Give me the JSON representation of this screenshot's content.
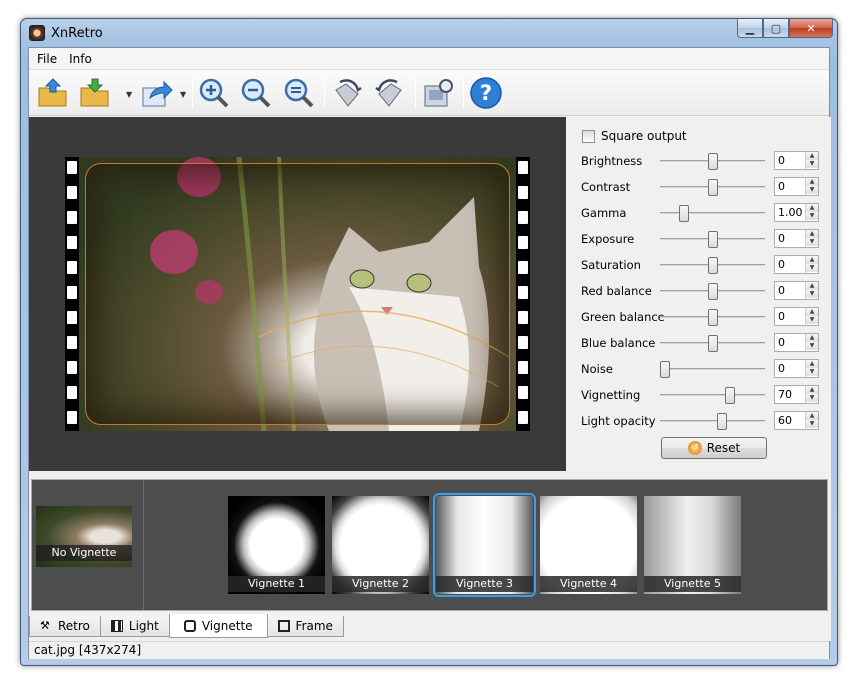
{
  "window": {
    "title": "XnRetro"
  },
  "menu": {
    "items": [
      "File",
      "Info"
    ]
  },
  "toolbar": {
    "buttons": [
      "open-icon",
      "save-icon",
      "share-icon",
      "zoom-in-icon",
      "zoom-out-icon",
      "zoom-fit-icon",
      "rotate-right-icon",
      "rotate-left-icon",
      "settings-icon",
      "help-icon"
    ]
  },
  "controls": {
    "square_output_label": "Square output",
    "square_output_checked": false,
    "sliders": [
      {
        "label": "Brightness",
        "value": "0",
        "level": 0.5
      },
      {
        "label": "Contrast",
        "value": "0",
        "level": 0.5
      },
      {
        "label": "Gamma",
        "value": "1.00",
        "level": 0.2
      },
      {
        "label": "Exposure",
        "value": "0",
        "level": 0.5
      },
      {
        "label": "Saturation",
        "value": "0",
        "level": 0.5
      },
      {
        "label": "Red balance",
        "value": "0",
        "level": 0.5
      },
      {
        "label": "Green balance",
        "value": "0",
        "level": 0.5
      },
      {
        "label": "Blue balance",
        "value": "0",
        "level": 0.5
      },
      {
        "label": "Noise",
        "value": "0",
        "level": 0.0
      },
      {
        "label": "Vignetting",
        "value": "70",
        "level": 0.68
      },
      {
        "label": "Light opacity",
        "value": "60",
        "level": 0.6
      }
    ],
    "reset_label": "Reset"
  },
  "gallery": {
    "current_label": "No Vignette",
    "items": [
      "Vignette 1",
      "Vignette 2",
      "Vignette 3",
      "Vignette 4",
      "Vignette 5"
    ],
    "selected_index": 2
  },
  "tabs": [
    "Retro",
    "Light",
    "Vignette",
    "Frame"
  ],
  "active_tab": "Vignette",
  "status": {
    "text": "cat.jpg [437x274]"
  },
  "colors": {
    "selection": "#3a9ee8",
    "preview_bg": "#3a3a3a",
    "gallery_bg": "#4d4d4d"
  }
}
